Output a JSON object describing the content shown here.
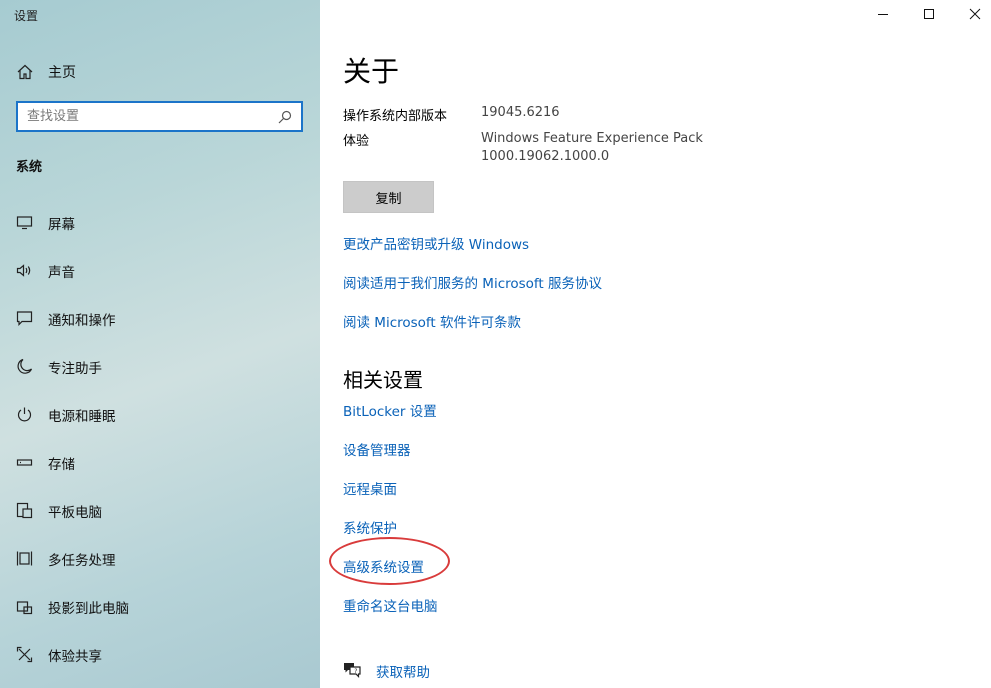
{
  "app": {
    "title": "设置"
  },
  "sidebar": {
    "home": {
      "label": "主页",
      "icon": "home-icon"
    },
    "search": {
      "placeholder": "查找设置",
      "value": ""
    },
    "section_label": "系统",
    "items": [
      {
        "label": "屏幕",
        "icon": "monitor-icon"
      },
      {
        "label": "声音",
        "icon": "speaker-icon"
      },
      {
        "label": "通知和操作",
        "icon": "notification-icon"
      },
      {
        "label": "专注助手",
        "icon": "moon-icon"
      },
      {
        "label": "电源和睡眠",
        "icon": "power-icon"
      },
      {
        "label": "存储",
        "icon": "storage-icon"
      },
      {
        "label": "平板电脑",
        "icon": "tablet-icon"
      },
      {
        "label": "多任务处理",
        "icon": "multitask-icon"
      },
      {
        "label": "投影到此电脑",
        "icon": "project-icon"
      },
      {
        "label": "体验共享",
        "icon": "share-icon"
      }
    ]
  },
  "main": {
    "title": "关于",
    "specs": [
      {
        "key": "操作系统内部版本",
        "value": "19045.6216"
      },
      {
        "key": "体验",
        "value": "Windows Feature Experience Pack",
        "value2": "1000.19062.1000.0"
      }
    ],
    "copy_label": "复制",
    "links": [
      "更改产品密钥或升级 Windows",
      "阅读适用于我们服务的 Microsoft 服务协议",
      "阅读 Microsoft 软件许可条款"
    ],
    "related_heading": "相关设置",
    "related_links": [
      "BitLocker 设置",
      "设备管理器",
      "远程桌面",
      "系统保护",
      "高级系统设置",
      "重命名这台电脑"
    ],
    "help_label": "获取帮助"
  },
  "colors": {
    "link": "#0a62b8",
    "highlight": "#d93b3b",
    "search_border": "#1b74c9"
  }
}
